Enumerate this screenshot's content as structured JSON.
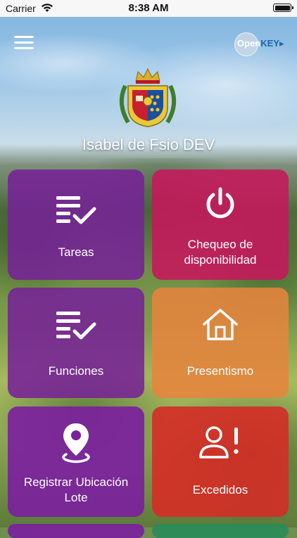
{
  "status_bar": {
    "carrier": "Carrier",
    "time": "8:38 AM"
  },
  "header": {
    "menu_icon": "hamburger-menu-icon",
    "brand_open": "Open",
    "brand_key": "KEY",
    "title": "Isabel de Fsio DEV"
  },
  "tiles": [
    {
      "label": "Tareas",
      "icon": "checklist-icon",
      "color": "#762296"
    },
    {
      "label": "Chequeo de disponibilidad",
      "icon": "power-icon",
      "color": "#c7175c"
    },
    {
      "label": "Funciones",
      "icon": "checklist-icon",
      "color": "#762296"
    },
    {
      "label": "Presentismo",
      "icon": "house-icon",
      "color": "#e6843e"
    },
    {
      "label": "Registrar Ubicación Lote",
      "icon": "location-pin-icon",
      "color": "#7b1ea0"
    },
    {
      "label": "Excedidos",
      "icon": "user-alert-icon",
      "color": "#d52c26"
    }
  ]
}
